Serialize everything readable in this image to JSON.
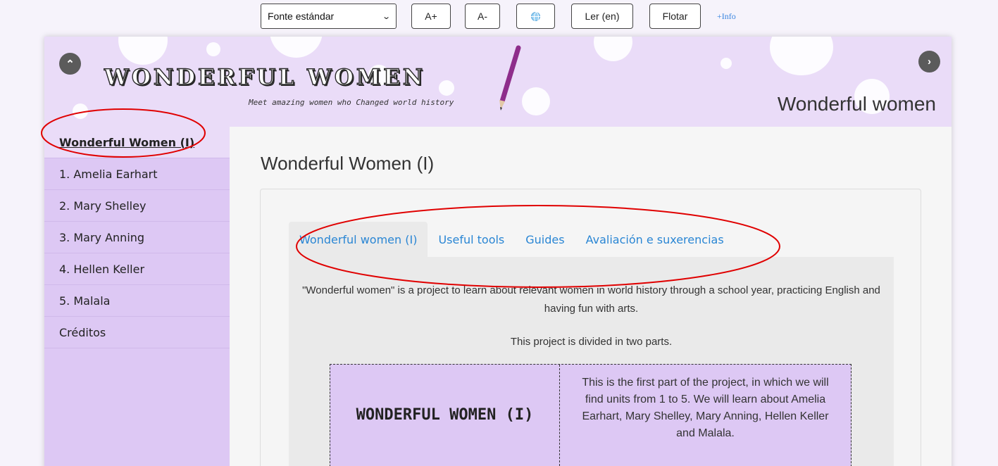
{
  "toolbar": {
    "font_select": "Fonte estándar",
    "increase_label": "A+",
    "decrease_label": "A-",
    "read_label": "Ler (en)",
    "float_label": "Flotar",
    "info_label": "+Info"
  },
  "header": {
    "logo_title": "WONDERFUL WOMEN",
    "logo_subtitle": "Meet amazing women who Changed world history",
    "title": "Wonderful women"
  },
  "sidebar": {
    "items": [
      {
        "label": "Wonderful Women (I)"
      },
      {
        "label": "1. Amelia Earhart"
      },
      {
        "label": "2. Mary Shelley"
      },
      {
        "label": "3. Mary Anning"
      },
      {
        "label": "4. Hellen Keller"
      },
      {
        "label": "5. Malala"
      },
      {
        "label": "Créditos"
      }
    ]
  },
  "main": {
    "page_title": "Wonderful Women (I)",
    "tabs": [
      {
        "label": "Wonderful women (I)"
      },
      {
        "label": "Useful tools"
      },
      {
        "label": "Guides"
      },
      {
        "label": "Avaliación e suxerencias"
      }
    ],
    "intro": "\"Wonderful women\" is a project to learn about relevant women in world history through a school year, practicing English and having fun with arts.",
    "intro2": "This project is divided in two parts.",
    "part_title": "WONDERFUL WOMEN (I)",
    "part_description": "This is the first part of the project, in which we will find units from 1 to 5. We will learn about Amelia Earhart, Mary Shelley, Mary Anning, Hellen Keller and Malala."
  },
  "colors": {
    "header_bg": "#eadcf8",
    "sidebar_bg": "#ddc8f4",
    "link": "#2a86d4",
    "annotation": "#e00000"
  }
}
